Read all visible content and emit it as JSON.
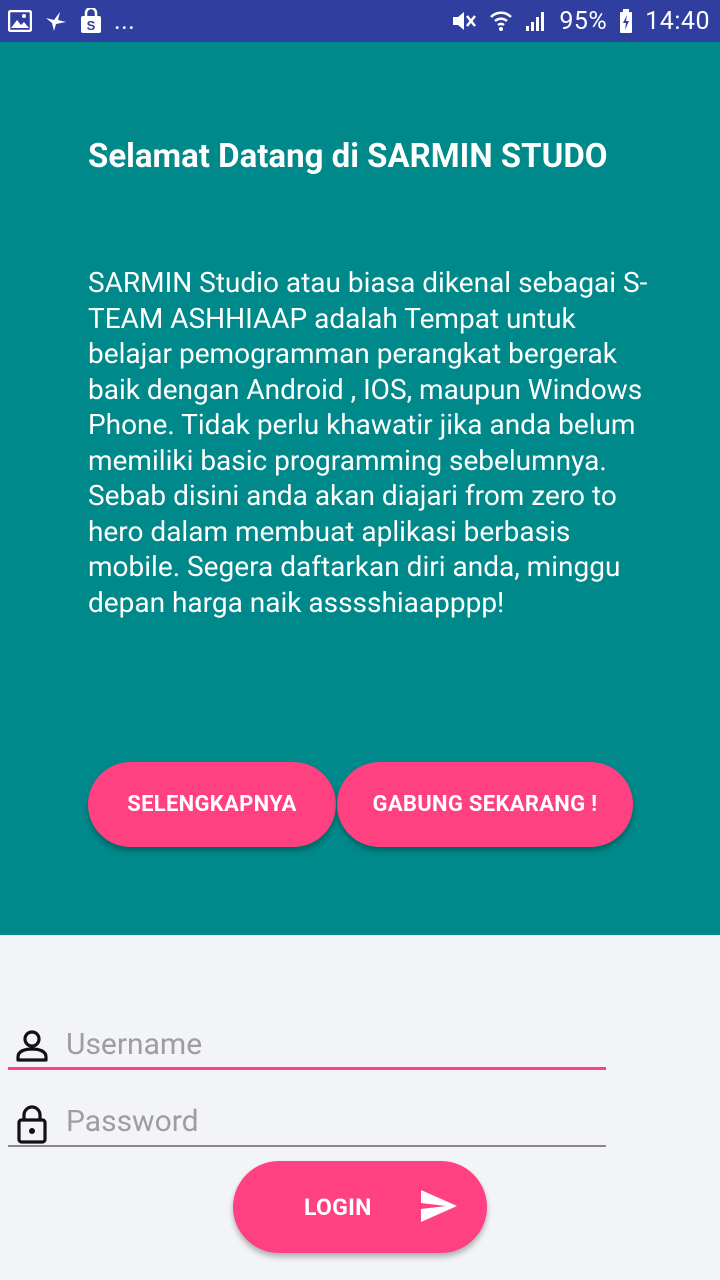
{
  "status_bar": {
    "left_icons": [
      "image-icon",
      "bird-icon",
      "shopping-bag-icon"
    ],
    "overflow": "...",
    "right_icons": [
      "mute-icon",
      "wifi-icon",
      "signal-icon",
      "battery-charging-icon"
    ],
    "battery": "95%",
    "time": "14:40"
  },
  "hero": {
    "background": "#00898a",
    "title": "Selamat Datang di SARMIN STUDO",
    "description": "SARMIN Studio atau biasa dikenal sebagai S-TEAM ASHHIAAP adalah Tempat untuk belajar pemogramman perangkat bergerak baik dengan Android , IOS, maupun Windows Phone. Tidak perlu khawatir jika anda belum memiliki basic programming sebelumnya. Sebab disini anda akan diajari from zero to hero dalam membuat aplikasi berbasis mobile. Segera daftarkan diri anda, minggu depan harga naik asssshiaapppp!",
    "more_button": "SELENGKAPNYA",
    "join_button": "GABUNG SEKARANG !"
  },
  "login": {
    "username_placeholder": "Username",
    "username_value": "",
    "password_placeholder": "Password",
    "password_value": "",
    "button_label": "LOGIN",
    "accent": "#ff4081"
  }
}
